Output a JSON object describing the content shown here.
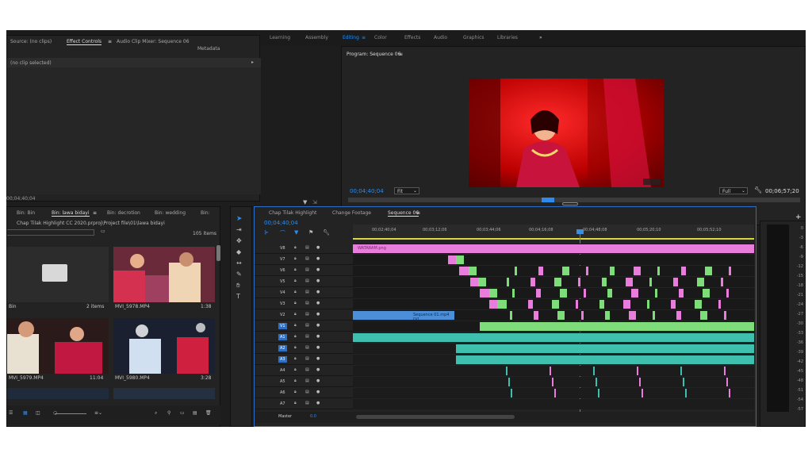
{
  "workspaces": [
    "Learning",
    "Assembly",
    "Editing",
    "Color",
    "Effects",
    "Audio",
    "Graphics",
    "Libraries"
  ],
  "active_workspace": "Editing",
  "overflow_glyph": "»",
  "source_panel": {
    "tabs": [
      "Source: (no clips)",
      "Effect Controls",
      "Audio Clip Mixer: Sequence 06",
      "Metadata"
    ],
    "active_tab": "Effect Controls",
    "status": "(no clip selected)",
    "timecode": "00;04;40;04"
  },
  "program_panel": {
    "title": "Program: Sequence 06",
    "timecode_current": "00;04;40;04",
    "fit": "Fit",
    "resolution": "Full",
    "timecode_duration": "00;06;57;20"
  },
  "project_panel": {
    "tabs": [
      "Bin: Bin",
      "Bin: lawa bidayi",
      "Bin: decrotion",
      "Bin: wedding",
      "Bin:"
    ],
    "active_tab": "Bin: lawa bidayi",
    "path": "Chap Tilak Highlight CC 2020.prproj\\Project file\\01\\lawa bidayi",
    "item_count": "105 items",
    "folder_label": "Bin",
    "folder_items": "2 items",
    "clips": [
      {
        "name": "MVI_5978.MP4",
        "duration": "1:38"
      },
      {
        "name": "MVI_5979.MP4",
        "duration": "11:04"
      },
      {
        "name": "MVI_5980.MP4",
        "duration": "3:28"
      }
    ]
  },
  "timeline": {
    "tabs": [
      "Chap Tilak Highlight",
      "Change Footage",
      "Sequence 06"
    ],
    "active_tab": "Sequence 06",
    "timecode": "00;04;40;04",
    "ruler": [
      "00;02;40;04",
      "00;03;12;06",
      "00;03;44;06",
      "00;04;16;08",
      "00;04;48;08",
      "00;05;20;10",
      "00;05;52;10"
    ],
    "video_tracks": [
      "V8",
      "V7",
      "V6",
      "V5",
      "V4",
      "V3",
      "V2",
      "V1"
    ],
    "audio_tracks": [
      "A1",
      "A2",
      "A3",
      "A4",
      "A5",
      "A6",
      "A7"
    ],
    "master_label": "Master",
    "master_value": "0.0",
    "clip_labels": {
      "graphic": "WATARAM.png",
      "nested": "Sequence 01.mp4 [V]"
    }
  },
  "meter_scale": [
    "0",
    "-3",
    "-6",
    "-9",
    "-12",
    "-15",
    "-18",
    "-21",
    "-24",
    "-27",
    "-30",
    "-33",
    "-36",
    "-39",
    "-42",
    "-45",
    "-48",
    "-51",
    "-54",
    "-57"
  ],
  "colors": {
    "accent": "#2d8ceb",
    "clip_pink": "#e97ddc",
    "clip_green": "#7fdc7a",
    "clip_blue": "#4a8fd8",
    "clip_teal": "#3fbfae",
    "playhead": "#3b8de0"
  }
}
